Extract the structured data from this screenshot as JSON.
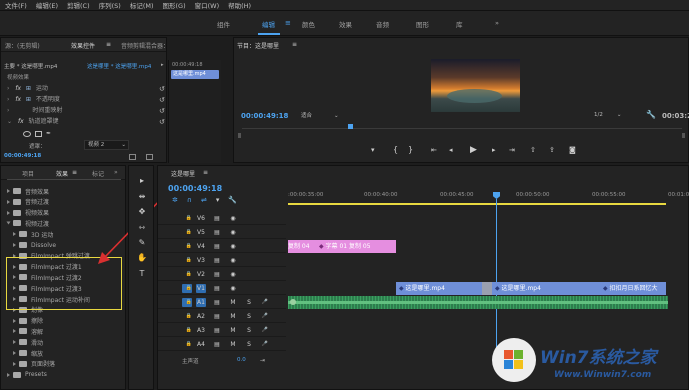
{
  "menu": [
    "文件(F)",
    "编辑(E)",
    "剪辑(C)",
    "序列(S)",
    "标记(M)",
    "图形(G)",
    "窗口(W)",
    "帮助(H)"
  ],
  "workspaces": {
    "items": [
      "组件",
      "编辑",
      "颜色",
      "效果",
      "音频",
      "图形",
      "库"
    ],
    "active": "编辑",
    "more": "»"
  },
  "left_top": {
    "tabs": [
      "源：(无剪辑)",
      "效果控件",
      "音频剪辑混合器：这是哪里"
    ],
    "active_tab": "效果控件",
    "menu_glyph": "≡",
    "clip_title": "主要 * 这是哪里.mp4",
    "clip_seq": "这是哪里 * 这是哪里.mp4",
    "mini_timecode": "00:00:49:18",
    "mini_clip": "这是哪里.mp4",
    "section": "视频效果",
    "rows": [
      "运动",
      "不透明度",
      "时间重映射",
      "轨道遮罩键"
    ],
    "mask_label": "遮罩：",
    "mask_value": "视频 2",
    "timecode": "00:00:49:18"
  },
  "program": {
    "title": "节目：这是哪里",
    "menu_glyph": "≡",
    "timecode": "00:00:49:18",
    "fit": "适合",
    "quality": "1/2",
    "duration": "00:03:2"
  },
  "effects_panel": {
    "tabs": [
      "项目",
      "效果",
      "标记"
    ],
    "active_tab": "效果",
    "menu_glyph": "≡",
    "more": "»",
    "items": [
      {
        "label": "音频效果",
        "indent": 0
      },
      {
        "label": "音频过渡",
        "indent": 0
      },
      {
        "label": "视频效果",
        "indent": 0
      },
      {
        "label": "视频过渡",
        "indent": 0,
        "open": true
      },
      {
        "label": "3D 运动",
        "indent": 1
      },
      {
        "label": "Dissolve",
        "indent": 1
      },
      {
        "label": "FilmImpact 弹跳过渡",
        "indent": 1
      },
      {
        "label": "FilmImpact 过渡1",
        "indent": 1
      },
      {
        "label": "FilmImpact 过渡2",
        "indent": 1
      },
      {
        "label": "FilmImpact 过渡3",
        "indent": 1
      },
      {
        "label": "FilmImpact 运动补间",
        "indent": 1
      },
      {
        "label": "划像",
        "indent": 1
      },
      {
        "label": "擦除",
        "indent": 1
      },
      {
        "label": "溶解",
        "indent": 1
      },
      {
        "label": "滑动",
        "indent": 1
      },
      {
        "label": "缩放",
        "indent": 1
      },
      {
        "label": "页面剥落",
        "indent": 1
      },
      {
        "label": "Presets",
        "indent": 0
      }
    ]
  },
  "timeline": {
    "title": "这是哪里",
    "menu_glyph": "≡",
    "timecode": "00:00:49:18",
    "ruler": [
      ":00:00:35:00",
      "00:00:40:00",
      "00:00:45:00",
      "00:00:50:00",
      "00:00:55:00",
      "00:01:00:00"
    ],
    "tracks": [
      {
        "name": "V6",
        "type": "v"
      },
      {
        "name": "V5",
        "type": "v"
      },
      {
        "name": "V4",
        "type": "v"
      },
      {
        "name": "V3",
        "type": "v"
      },
      {
        "name": "V2",
        "type": "v"
      },
      {
        "name": "V1",
        "type": "v",
        "target": true
      },
      {
        "name": "A1",
        "type": "a",
        "target": true
      },
      {
        "name": "A2",
        "type": "a"
      },
      {
        "name": "A3",
        "type": "a"
      },
      {
        "name": "A4",
        "type": "a"
      }
    ],
    "master_label": "主声道",
    "master_value": "0.0",
    "track_btn_m": "M",
    "track_btn_s": "S",
    "clips_v4": [
      "复制 04",
      "字幕 01 复制 05"
    ],
    "clips_v1": [
      "这是哪里.mp4",
      "这是哪里.mp4",
      "扣扣月日系回忆大"
    ]
  },
  "tools": [
    "▸",
    "⇹",
    "✥",
    "⇿",
    "✎",
    "✋",
    "T"
  ],
  "watermark": {
    "brand": "Win7系统之家",
    "url": "Www.Winwin7.com"
  },
  "colors": {
    "accent": "#4da3f0",
    "clip_blue": "#6f8fd8",
    "clip_pink": "#e58ee0",
    "audio_green": "#2d7d4d",
    "annot": "#e8d840",
    "arrow": "#d93030"
  }
}
